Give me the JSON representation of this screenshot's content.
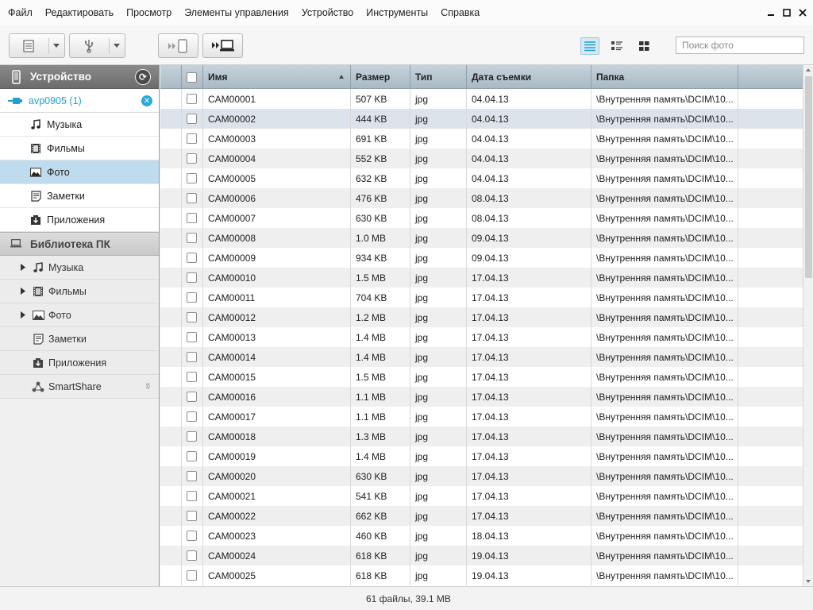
{
  "menu": [
    "Файл",
    "Редактировать",
    "Просмотр",
    "Элементы управления",
    "Устройство",
    "Инструменты",
    "Справка"
  ],
  "window_controls": {
    "minimize": "–",
    "maximize": "☐",
    "close": "✕"
  },
  "toolbar": {
    "icons": [
      "file-list-icon",
      "usb-icon",
      "send-to-device-icon",
      "send-to-pc-icon",
      "list-view-icon",
      "detail-view-icon",
      "grid-view-icon"
    ],
    "search_placeholder": "Поиск фото"
  },
  "sidebar": {
    "device_header": "Устройство",
    "device_name": "avp0905 (1)",
    "device_items": [
      {
        "label": "Музыка",
        "icon": "music-icon"
      },
      {
        "label": "Фильмы",
        "icon": "film-icon"
      },
      {
        "label": "Фото",
        "icon": "photo-icon",
        "selected": true
      },
      {
        "label": "Заметки",
        "icon": "notes-icon"
      },
      {
        "label": "Приложения",
        "icon": "apps-icon"
      }
    ],
    "library_header": "Библиотека ПК",
    "library_items": [
      {
        "label": "Музыка",
        "icon": "music-icon",
        "expandable": true
      },
      {
        "label": "Фильмы",
        "icon": "film-icon",
        "expandable": true
      },
      {
        "label": "Фото",
        "icon": "photo-icon",
        "expandable": true
      },
      {
        "label": "Заметки",
        "icon": "notes-icon",
        "expandable": false
      },
      {
        "label": "Приложения",
        "icon": "apps-icon",
        "expandable": false
      },
      {
        "label": "SmartShare",
        "icon": "smartshare-icon",
        "expandable": false
      }
    ]
  },
  "table": {
    "columns": [
      "Имя",
      "Размер",
      "Тип",
      "Дата съемки",
      "Папка"
    ],
    "sorted_column": "Имя",
    "rows": [
      [
        "CAM00001",
        "507 KB",
        "jpg",
        "04.04.13",
        "\\Внутренняя память\\DCIM\\10..."
      ],
      [
        "CAM00002",
        "444 KB",
        "jpg",
        "04.04.13",
        "\\Внутренняя память\\DCIM\\10..."
      ],
      [
        "CAM00003",
        "691 KB",
        "jpg",
        "04.04.13",
        "\\Внутренняя память\\DCIM\\10..."
      ],
      [
        "CAM00004",
        "552 KB",
        "jpg",
        "04.04.13",
        "\\Внутренняя память\\DCIM\\10..."
      ],
      [
        "CAM00005",
        "632 KB",
        "jpg",
        "04.04.13",
        "\\Внутренняя память\\DCIM\\10..."
      ],
      [
        "CAM00006",
        "476 KB",
        "jpg",
        "08.04.13",
        "\\Внутренняя память\\DCIM\\10..."
      ],
      [
        "CAM00007",
        "630 KB",
        "jpg",
        "08.04.13",
        "\\Внутренняя память\\DCIM\\10..."
      ],
      [
        "CAM00008",
        "1.0 MB",
        "jpg",
        "09.04.13",
        "\\Внутренняя память\\DCIM\\10..."
      ],
      [
        "CAM00009",
        "934 KB",
        "jpg",
        "09.04.13",
        "\\Внутренняя память\\DCIM\\10..."
      ],
      [
        "CAM00010",
        "1.5 MB",
        "jpg",
        "17.04.13",
        "\\Внутренняя память\\DCIM\\10..."
      ],
      [
        "CAM00011",
        "704 KB",
        "jpg",
        "17.04.13",
        "\\Внутренняя память\\DCIM\\10..."
      ],
      [
        "CAM00012",
        "1.2 MB",
        "jpg",
        "17.04.13",
        "\\Внутренняя память\\DCIM\\10..."
      ],
      [
        "CAM00013",
        "1.4 MB",
        "jpg",
        "17.04.13",
        "\\Внутренняя память\\DCIM\\10..."
      ],
      [
        "CAM00014",
        "1.4 MB",
        "jpg",
        "17.04.13",
        "\\Внутренняя память\\DCIM\\10..."
      ],
      [
        "CAM00015",
        "1.5 MB",
        "jpg",
        "17.04.13",
        "\\Внутренняя память\\DCIM\\10..."
      ],
      [
        "CAM00016",
        "1.1 MB",
        "jpg",
        "17.04.13",
        "\\Внутренняя память\\DCIM\\10..."
      ],
      [
        "CAM00017",
        "1.1 MB",
        "jpg",
        "17.04.13",
        "\\Внутренняя память\\DCIM\\10..."
      ],
      [
        "CAM00018",
        "1.3 MB",
        "jpg",
        "17.04.13",
        "\\Внутренняя память\\DCIM\\10..."
      ],
      [
        "CAM00019",
        "1.4 MB",
        "jpg",
        "17.04.13",
        "\\Внутренняя память\\DCIM\\10..."
      ],
      [
        "CAM00020",
        "630 KB",
        "jpg",
        "17.04.13",
        "\\Внутренняя память\\DCIM\\10..."
      ],
      [
        "CAM00021",
        "541 KB",
        "jpg",
        "17.04.13",
        "\\Внутренняя память\\DCIM\\10..."
      ],
      [
        "CAM00022",
        "662 KB",
        "jpg",
        "17.04.13",
        "\\Внутренняя память\\DCIM\\10..."
      ],
      [
        "CAM00023",
        "460 KB",
        "jpg",
        "18.04.13",
        "\\Внутренняя память\\DCIM\\10..."
      ],
      [
        "CAM00024",
        "618 KB",
        "jpg",
        "19.04.13",
        "\\Внутренняя память\\DCIM\\10..."
      ],
      [
        "CAM00025",
        "618 KB",
        "jpg",
        "19.04.13",
        "\\Внутренняя память\\DCIM\\10..."
      ]
    ],
    "selected_row": 2
  },
  "status": "61 файлы, 39.1 MB",
  "colors": {
    "accent": "#1f9fd6",
    "selection": "#bfdcee",
    "header": "#aab9c4"
  }
}
